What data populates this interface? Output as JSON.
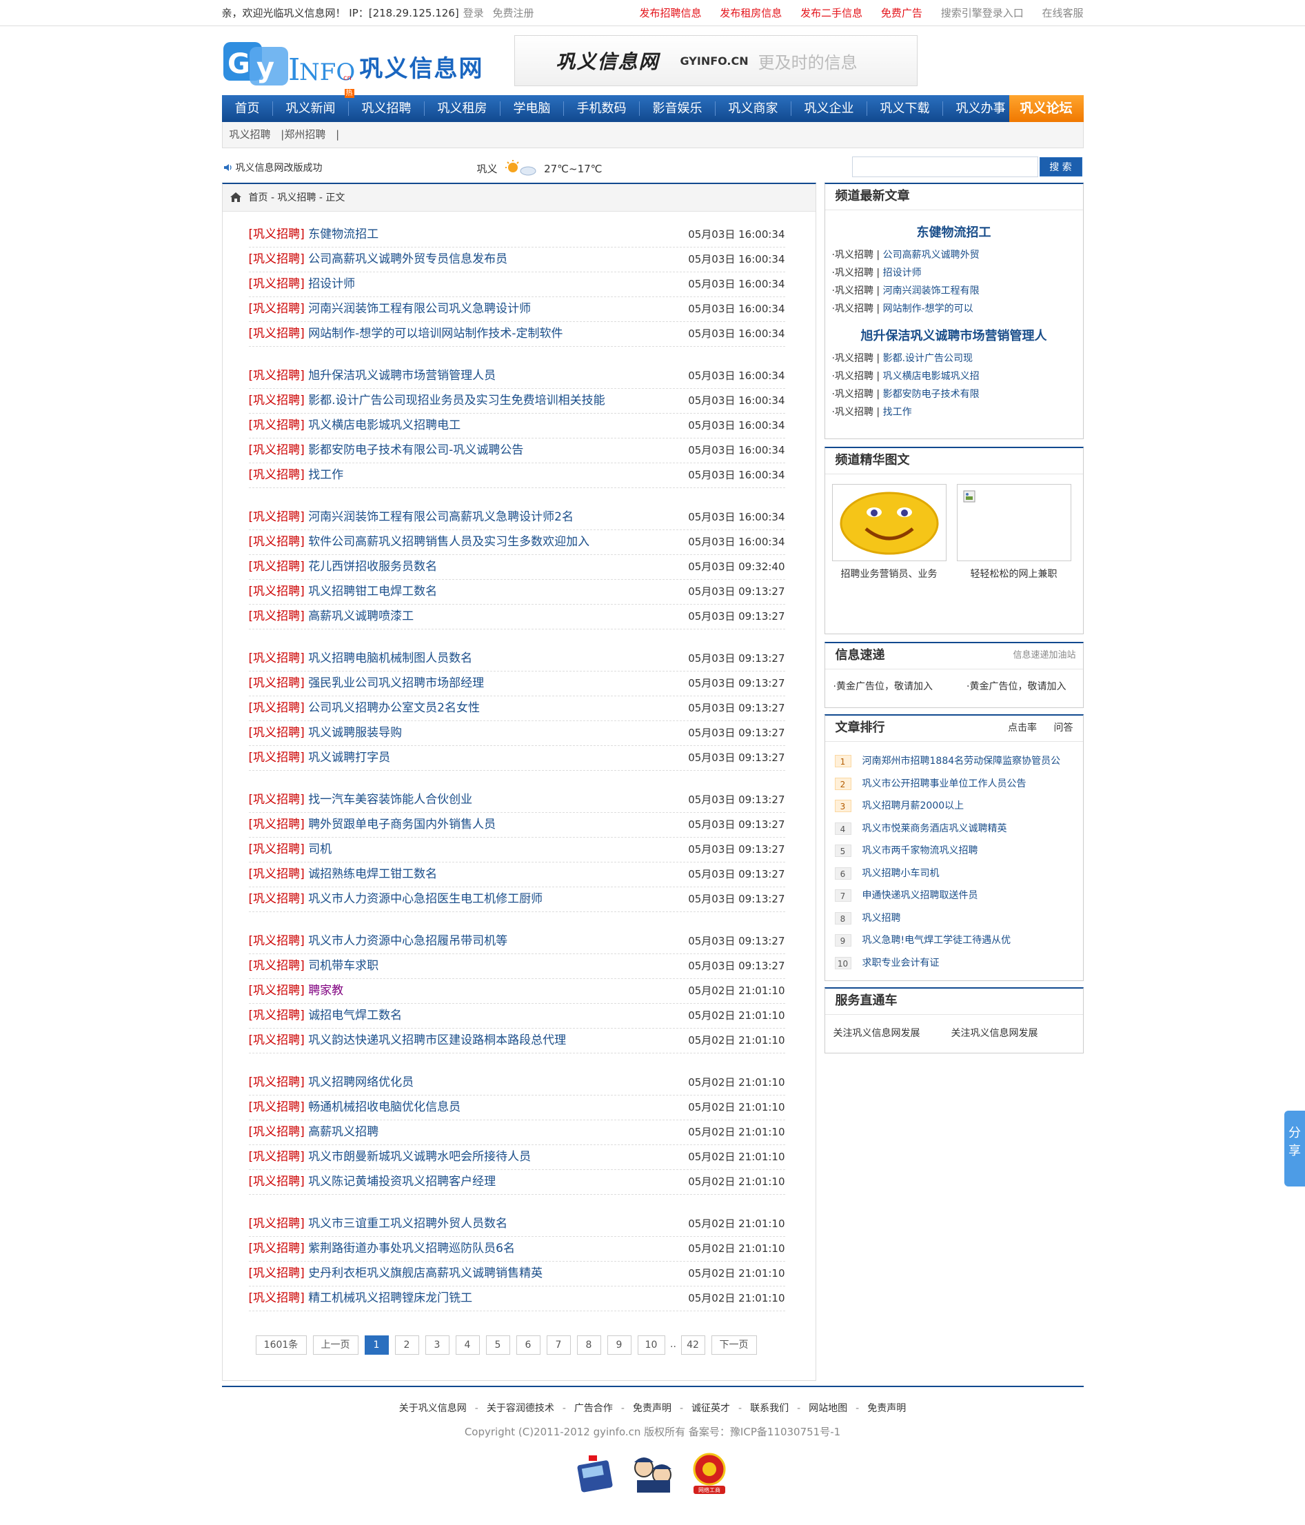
{
  "topbar": {
    "welcome": "亲，欢迎光临巩义信息网！ IP：[218.29.125.126]",
    "login": "登录",
    "register": "免费注册",
    "links": [
      "发布招聘信息",
      "发布租房信息",
      "发布二手信息",
      "免费广告",
      "搜索引擎登录入口",
      "在线客服"
    ]
  },
  "header": {
    "logo_text": "巩义信息网",
    "logo_letters": "GyINFO",
    "banner_title": "巩义信息网",
    "banner_domain": "GYINFO.CN",
    "banner_slogan": "更及时的信息"
  },
  "nav": {
    "items": [
      "首页",
      "巩义新闻",
      "巩义招聘",
      "巩义租房",
      "学电脑",
      "手机数码",
      "影音娱乐",
      "巩义商家",
      "巩义企业",
      "巩义下载",
      "巩义办事"
    ],
    "hot": "热",
    "forum": "巩义论坛"
  },
  "subnav": {
    "items": [
      "巩义招聘",
      "|郑州招聘",
      "|"
    ]
  },
  "infobar": {
    "notice": "巩义信息网改版成功",
    "city": "巩义",
    "temp": "27℃~17℃",
    "search_placeholder": "",
    "search_button": "搜 索"
  },
  "breadcrumb": "首页 - 巩义招聘 - 正文",
  "articles": {
    "category": "巩义招聘",
    "groups": [
      [
        {
          "title": "东健物流招工",
          "date": "05月03日 16:00:34"
        },
        {
          "title": "公司高薪巩义诚聘外贸专员信息发布员",
          "date": "05月03日 16:00:34"
        },
        {
          "title": "招设计师",
          "date": "05月03日 16:00:34"
        },
        {
          "title": "河南兴润装饰工程有限公司巩义急聘设计师",
          "date": "05月03日 16:00:34"
        },
        {
          "title": "网站制作-想学的可以培训网站制作技术-定制软件",
          "date": "05月03日 16:00:34"
        }
      ],
      [
        {
          "title": "旭升保洁巩义诚聘市场营销管理人员",
          "date": "05月03日 16:00:34"
        },
        {
          "title": "影都.设计广告公司现招业务员及实习生免费培训相关技能",
          "date": "05月03日 16:00:34"
        },
        {
          "title": "巩义横店电影城巩义招聘电工",
          "date": "05月03日 16:00:34"
        },
        {
          "title": "影都安防电子技术有限公司-巩义诚聘公告",
          "date": "05月03日 16:00:34"
        },
        {
          "title": "找工作",
          "date": "05月03日 16:00:34"
        }
      ],
      [
        {
          "title": "河南兴润装饰工程有限公司高薪巩义急聘设计师2名",
          "date": "05月03日 16:00:34"
        },
        {
          "title": "软件公司高薪巩义招聘销售人员及实习生多数欢迎加入",
          "date": "05月03日 16:00:34"
        },
        {
          "title": "花儿西饼招收服务员数名",
          "date": "05月03日 09:32:40"
        },
        {
          "title": "巩义招聘钳工电焊工数名",
          "date": "05月03日 09:13:27"
        },
        {
          "title": "高薪巩义诚聘喷漆工",
          "date": "05月03日 09:13:27"
        }
      ],
      [
        {
          "title": "巩义招聘电脑机械制图人员数名",
          "date": "05月03日 09:13:27"
        },
        {
          "title": "强民乳业公司巩义招聘市场部经理",
          "date": "05月03日 09:13:27"
        },
        {
          "title": "公司巩义招聘办公室文员2名女性",
          "date": "05月03日 09:13:27"
        },
        {
          "title": "巩义诚聘服装导购",
          "date": "05月03日 09:13:27"
        },
        {
          "title": "巩义诚聘打字员",
          "date": "05月03日 09:13:27"
        }
      ],
      [
        {
          "title": "找一汽车美容装饰能人合伙创业",
          "date": "05月03日 09:13:27"
        },
        {
          "title": "聘外贸跟单电子商务国内外销售人员",
          "date": "05月03日 09:13:27"
        },
        {
          "title": "司机",
          "date": "05月03日 09:13:27"
        },
        {
          "title": "诚招熟练电焊工钳工数名",
          "date": "05月03日 09:13:27"
        },
        {
          "title": "巩义市人力资源中心急招医生电工机修工厨师",
          "date": "05月03日 09:13:27"
        }
      ],
      [
        {
          "title": "巩义市人力资源中心急招履吊带司机等",
          "date": "05月03日 09:13:27"
        },
        {
          "title": "司机带车求职",
          "date": "05月03日 09:13:27"
        },
        {
          "title": "聘家教",
          "date": "05月02日 21:01:10",
          "visited": true
        },
        {
          "title": "诚招电气焊工数名",
          "date": "05月02日 21:01:10"
        },
        {
          "title": "巩义韵达快递巩义招聘市区建设路桐本路段总代理",
          "date": "05月02日 21:01:10"
        }
      ],
      [
        {
          "title": "巩义招聘网络优化员",
          "date": "05月02日 21:01:10"
        },
        {
          "title": "畅通机械招收电脑优化信息员",
          "date": "05月02日 21:01:10"
        },
        {
          "title": "高薪巩义招聘",
          "date": "05月02日 21:01:10"
        },
        {
          "title": "巩义市朗曼新城巩义诚聘水吧会所接待人员",
          "date": "05月02日 21:01:10"
        },
        {
          "title": "巩义陈记黄埔投资巩义招聘客户经理",
          "date": "05月02日 21:01:10"
        }
      ],
      [
        {
          "title": "巩义市三谊重工巩义招聘外贸人员数名",
          "date": "05月02日 21:01:10"
        },
        {
          "title": "紫荆路街道办事处巩义招聘巡防队员6名",
          "date": "05月02日 21:01:10"
        },
        {
          "title": "史丹利衣柜巩义旗舰店高薪巩义诚聘销售精英",
          "date": "05月02日 21:01:10"
        },
        {
          "title": "精工机械巩义招聘镗床龙门铣工",
          "date": "05月02日 21:01:10"
        }
      ]
    ]
  },
  "pager": {
    "total": "1601条",
    "prev": "上一页",
    "pages": [
      "1",
      "2",
      "3",
      "4",
      "5",
      "6",
      "7",
      "8",
      "9",
      "10"
    ],
    "dots": "..",
    "last": "42",
    "next": "下一页",
    "current": "1"
  },
  "sidebar": {
    "latest": {
      "title": "频道最新文章",
      "blocks": [
        {
          "headline": "东健物流招工",
          "items": [
            "公司高薪巩义诚聘外贸",
            "招设计师",
            "河南兴润装饰工程有限",
            "网站制作-想学的可以"
          ]
        },
        {
          "headline": "旭升保洁巩义诚聘市场营销管理人",
          "items": [
            "影都.设计广告公司现",
            "巩义横店电影城巩义招",
            "影都安防电子技术有限",
            "找工作"
          ]
        }
      ],
      "prefix": "·巩义招聘 | "
    },
    "pics": {
      "title": "频道精华图文",
      "items": [
        {
          "caption": "招聘业务营销员、业务"
        },
        {
          "caption": "轻轻松松的网上兼职"
        }
      ]
    },
    "quick": {
      "title": "信息速递",
      "more": "信息速递加油站",
      "items": [
        "·黄金广告位，敬请加入",
        "·黄金广告位，敬请加入"
      ]
    },
    "rank": {
      "title": "文章排行",
      "tabs": [
        "点击率",
        "问答"
      ],
      "items": [
        "河南郑州市招聘1884名劳动保障监察协管员公",
        "巩义市公开招聘事业单位工作人员公告",
        "巩义招聘月薪2000以上",
        "巩义市悦莱商务酒店巩义诚聘精英",
        "巩义市两千家物流巩义招聘",
        "巩义招聘小车司机",
        "申通快递巩义招聘取送件员",
        "巩义招聘",
        "巩义急聘!电气焊工学徒工待遇从优",
        "求职专业会计有证"
      ]
    },
    "service": {
      "title": "服务直通车",
      "items": [
        "关注巩义信息网发展",
        "关注巩义信息网发展"
      ]
    }
  },
  "footer": {
    "links": [
      "关于巩义信息网",
      "关于容润德技术",
      "广告合作",
      "免责声明",
      "诚征英才",
      "联系我们",
      "网站地图",
      "免责声明"
    ],
    "copyright": "Copyright (C)2011-2012 gyinfo.cn 版权所有 备案号：豫ICP备11030751号-1",
    "badge_text": "网络工商"
  },
  "share": "分享",
  "colors": {
    "nav": "#11498f",
    "forum": "#f07800",
    "category": "#cc0000",
    "link": "#1a4e8a"
  }
}
